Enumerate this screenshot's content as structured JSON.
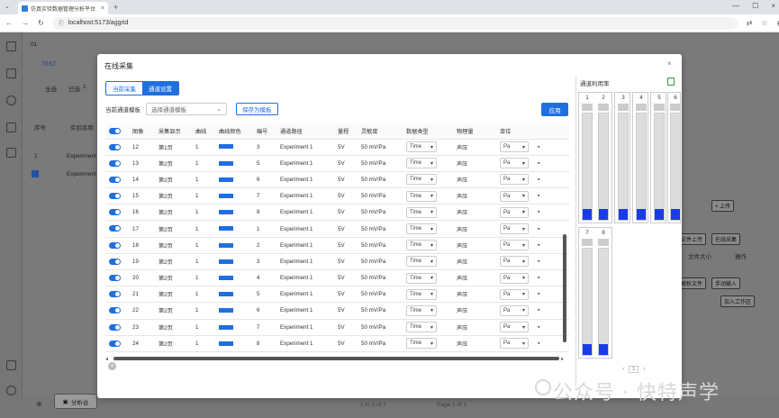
{
  "browser": {
    "tab_title": "仿真实验数据管理分析平台",
    "url": "localhost:5173/aggrid"
  },
  "background": {
    "breadcrumb": "01",
    "tab": "TEST",
    "select_all": "全选",
    "selected": "已选",
    "selected_count": "1",
    "col_seq": "序号",
    "col_name": "实验名称",
    "row1_seq": "1",
    "row1_name": "Experiment",
    "row2_name": "Experiment",
    "upload_btn": "+ 上传",
    "file_upload": "文件上传",
    "online_capture": "在线采集",
    "file_size": "文件大小",
    "operation": "操作",
    "parse_file": "解析文件",
    "manual_input": "手动输入",
    "add_workspace": "加入工作区",
    "analysis_btn": "分析台",
    "page_info_left": "1 to 2 of 2",
    "page_info_right": "Page 1 of 1"
  },
  "modal": {
    "title": "在线采集",
    "tabs": [
      "当前采集",
      "通道设置"
    ],
    "template_label": "当前通道模板",
    "template_placeholder": "选择通道模板",
    "save_template": "保存为模板",
    "apply": "应用",
    "headers": [
      "图像",
      "采集显示",
      "曲线",
      "曲线颜色",
      "编号",
      "通道路径",
      "量程",
      "灵敏度",
      "数据类型",
      "物理量",
      "单位"
    ],
    "rows": [
      {
        "img": "12",
        "disp": "第1页",
        "curve": "1",
        "num": "3",
        "path": "Experiment 1",
        "range": "5V",
        "sens": "50 mV/Pa",
        "dtype": "Time",
        "phys": "声压",
        "unit": "Pa"
      },
      {
        "img": "13",
        "disp": "第2页",
        "curve": "1",
        "num": "5",
        "path": "Experiment 1",
        "range": "5V",
        "sens": "50 mV/Pa",
        "dtype": "Time",
        "phys": "声压",
        "unit": "Pa"
      },
      {
        "img": "14",
        "disp": "第2页",
        "curve": "1",
        "num": "6",
        "path": "Experiment 1",
        "range": "5V",
        "sens": "50 mV/Pa",
        "dtype": "Time",
        "phys": "声压",
        "unit": "Pa"
      },
      {
        "img": "15",
        "disp": "第2页",
        "curve": "1",
        "num": "7",
        "path": "Experiment 1",
        "range": "5V",
        "sens": "50 mV/Pa",
        "dtype": "Time",
        "phys": "声压",
        "unit": "Pa"
      },
      {
        "img": "16",
        "disp": "第2页",
        "curve": "1",
        "num": "8",
        "path": "Experiment 1",
        "range": "5V",
        "sens": "50 mV/Pa",
        "dtype": "Time",
        "phys": "声压",
        "unit": "Pa"
      },
      {
        "img": "17",
        "disp": "第2页",
        "curve": "1",
        "num": "1",
        "path": "Experiment 1",
        "range": "5V",
        "sens": "50 mV/Pa",
        "dtype": "Time",
        "phys": "声压",
        "unit": "Pa"
      },
      {
        "img": "18",
        "disp": "第2页",
        "curve": "1",
        "num": "2",
        "path": "Experiment 1",
        "range": "5V",
        "sens": "50 mV/Pa",
        "dtype": "Time",
        "phys": "声压",
        "unit": "Pa"
      },
      {
        "img": "19",
        "disp": "第2页",
        "curve": "1",
        "num": "3",
        "path": "Experiment 1",
        "range": "5V",
        "sens": "50 mV/Pa",
        "dtype": "Time",
        "phys": "声压",
        "unit": "Pa"
      },
      {
        "img": "20",
        "disp": "第2页",
        "curve": "1",
        "num": "4",
        "path": "Experiment 1",
        "range": "5V",
        "sens": "50 mV/Pa",
        "dtype": "Time",
        "phys": "声压",
        "unit": "Pa"
      },
      {
        "img": "21",
        "disp": "第2页",
        "curve": "1",
        "num": "5",
        "path": "Experiment 1",
        "range": "5V",
        "sens": "50 mV/Pa",
        "dtype": "Time",
        "phys": "声压",
        "unit": "Pa"
      },
      {
        "img": "22",
        "disp": "第2页",
        "curve": "1",
        "num": "6",
        "path": "Experiment 1",
        "range": "5V",
        "sens": "50 mV/Pa",
        "dtype": "Time",
        "phys": "声压",
        "unit": "Pa"
      },
      {
        "img": "23",
        "disp": "第2页",
        "curve": "1",
        "num": "7",
        "path": "Experiment 1",
        "range": "5V",
        "sens": "50 mV/Pa",
        "dtype": "Time",
        "phys": "声压",
        "unit": "Pa"
      },
      {
        "img": "24",
        "disp": "第2页",
        "curve": "1",
        "num": "8",
        "path": "Experiment 1",
        "range": "5V",
        "sens": "50 mV/Pa",
        "dtype": "Time",
        "phys": "声压",
        "unit": "Pa"
      }
    ],
    "curve_color": "#1f6fe0"
  },
  "util": {
    "title": "通道利用率",
    "channels": [
      {
        "label": "1",
        "level": 0.1
      },
      {
        "label": "2",
        "level": 0.1
      },
      {
        "label": "3",
        "level": 0.1
      },
      {
        "label": "4",
        "level": 0.1
      },
      {
        "label": "5",
        "level": 0.1
      },
      {
        "label": "6",
        "level": 0.1
      },
      {
        "label": "7",
        "level": 0.1
      },
      {
        "label": "8",
        "level": 0.1
      }
    ],
    "page": "1",
    "fill_color": "#1a3ce8"
  },
  "watermark": "公众号 · 快特声学"
}
